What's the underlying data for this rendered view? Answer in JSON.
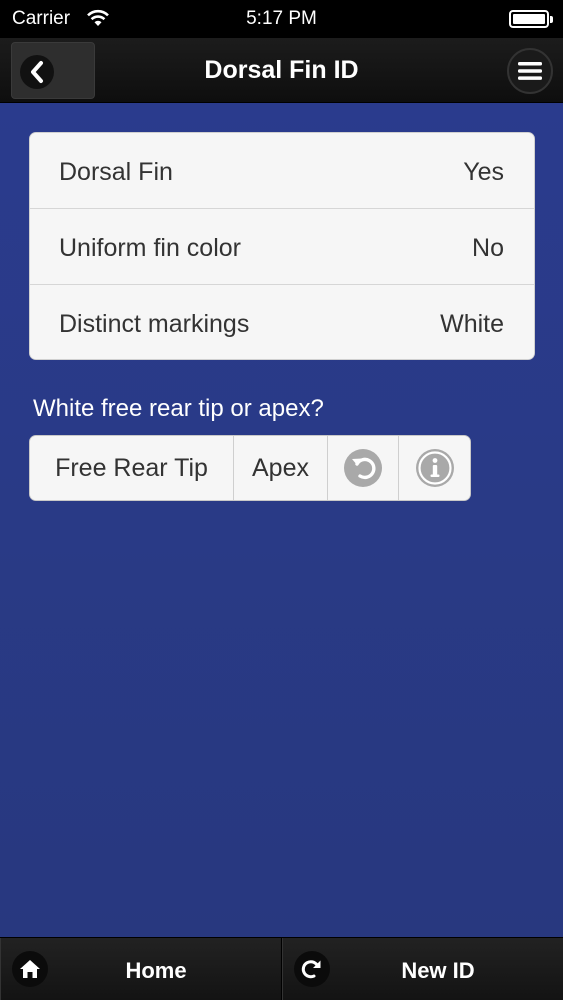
{
  "status_bar": {
    "carrier": "Carrier",
    "time": "5:17 PM"
  },
  "header": {
    "title": "Dorsal Fin ID",
    "back_icon": "chevron-left-icon",
    "menu_icon": "hamburger-menu-icon"
  },
  "summary": {
    "rows": [
      {
        "label": "Dorsal Fin",
        "value": "Yes"
      },
      {
        "label": "Uniform fin color",
        "value": "No"
      },
      {
        "label": "Distinct markings",
        "value": "White"
      }
    ]
  },
  "question": {
    "text": "White free rear tip or apex?"
  },
  "options": {
    "free_rear_tip": "Free Rear Tip",
    "apex": "Apex",
    "undo_icon": "undo-icon",
    "info_icon": "info-icon"
  },
  "footer": {
    "home_label": "Home",
    "home_icon": "home-icon",
    "new_id_label": "New ID",
    "new_id_icon": "redo-icon"
  },
  "colors": {
    "background": "#2a3b8d",
    "header": "#1c1c1c",
    "list_bg": "#f6f6f6",
    "icon_gray": "#a9a9a9"
  }
}
